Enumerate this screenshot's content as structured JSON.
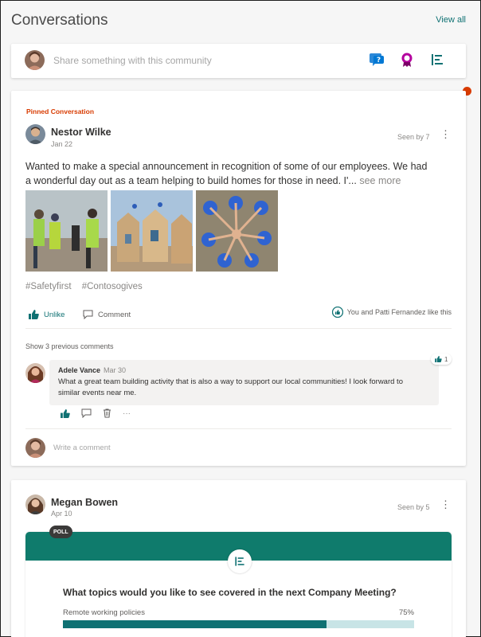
{
  "header": {
    "title": "Conversations",
    "view_all": "View all"
  },
  "composer": {
    "placeholder": "Share something with this community",
    "actions": [
      "question-icon",
      "praise-icon",
      "poll-icon"
    ]
  },
  "post1": {
    "label": "Pinned Conversation",
    "author": "Nestor Wilke",
    "date": "Jan 22",
    "seen": "Seen by 7",
    "text": "Wanted to make a special announcement in recognition of some of our employees. We had a wonderful day out as a team helping to build homes for those in need. I'...",
    "see_more": "see more",
    "tags": [
      "#Safetyfirst",
      "#Contosogives"
    ],
    "unlike": "Unlike",
    "comment": "Comment",
    "liked_by": "You and Patti Fernandez like this",
    "prev_comments": "Show 3 previous comments",
    "reply": {
      "author": "Adele Vance",
      "date": "Mar 30",
      "text": "What a great team building activity that is also a way to support our local communities! I look forward to similar events near me.",
      "likes": "1"
    },
    "write_comment": "Write a comment"
  },
  "post2": {
    "author": "Megan Bowen",
    "date": "Apr 10",
    "seen": "Seen by 5",
    "poll": {
      "tag": "POLL",
      "question": "What topics would you like to see covered in the next Company Meeting?",
      "option": "Remote working policies",
      "percent": "75%",
      "fill": 0.75
    }
  },
  "colors": {
    "accent": "#0f7173",
    "pinned": "#d83b01",
    "poll_band": "#0f7b6c"
  }
}
